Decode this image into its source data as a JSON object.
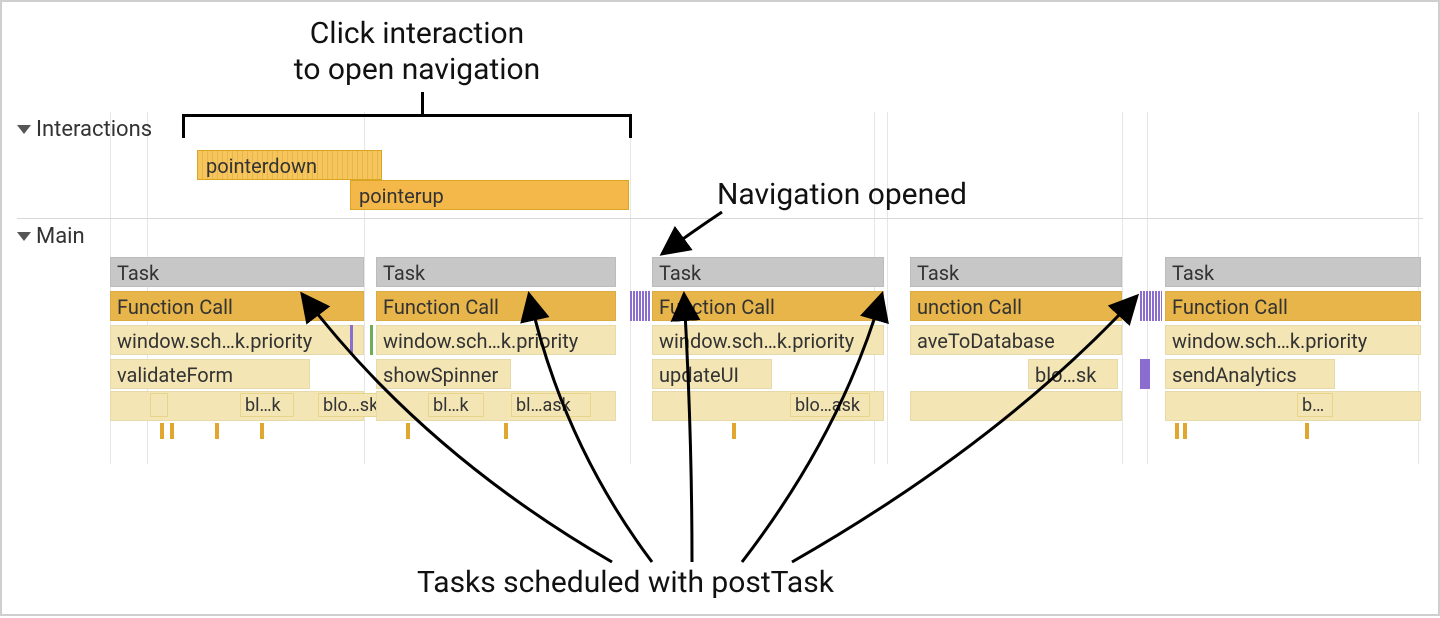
{
  "annotations": {
    "top": "Click interaction\nto open navigation",
    "right": "Navigation opened",
    "bottom": "Tasks scheduled with postTask"
  },
  "tracks": {
    "interactions_label": "Interactions",
    "main_label": "Main"
  },
  "interactions": {
    "pointerdown": "pointerdown",
    "pointerup": "pointerup"
  },
  "main": {
    "groups": [
      {
        "task": "Task",
        "fn": "Function Call",
        "a": "window.sch…k.priority",
        "b": "validateForm",
        "subs": [
          "bl…k",
          "blo…sk"
        ]
      },
      {
        "task": "Task",
        "fn": "Function Call",
        "a": "window.sch…k.priority",
        "b": "showSpinner",
        "subs": [
          "bl…k",
          "bl…ask"
        ]
      },
      {
        "task": "Task",
        "fn": "Function Call",
        "a": "window.sch…k.priority",
        "b": "updateUI",
        "subs": [
          "blo…ask"
        ]
      },
      {
        "task": "Task",
        "fn": "unction Call",
        "a": "aveToDatabase",
        "b": "",
        "subs": [
          "blo…sk"
        ]
      },
      {
        "task": "Task",
        "fn": "Function Call",
        "a": "window.sch…k.priority",
        "b": "sendAnalytics",
        "subs": [
          "b…"
        ]
      }
    ]
  }
}
